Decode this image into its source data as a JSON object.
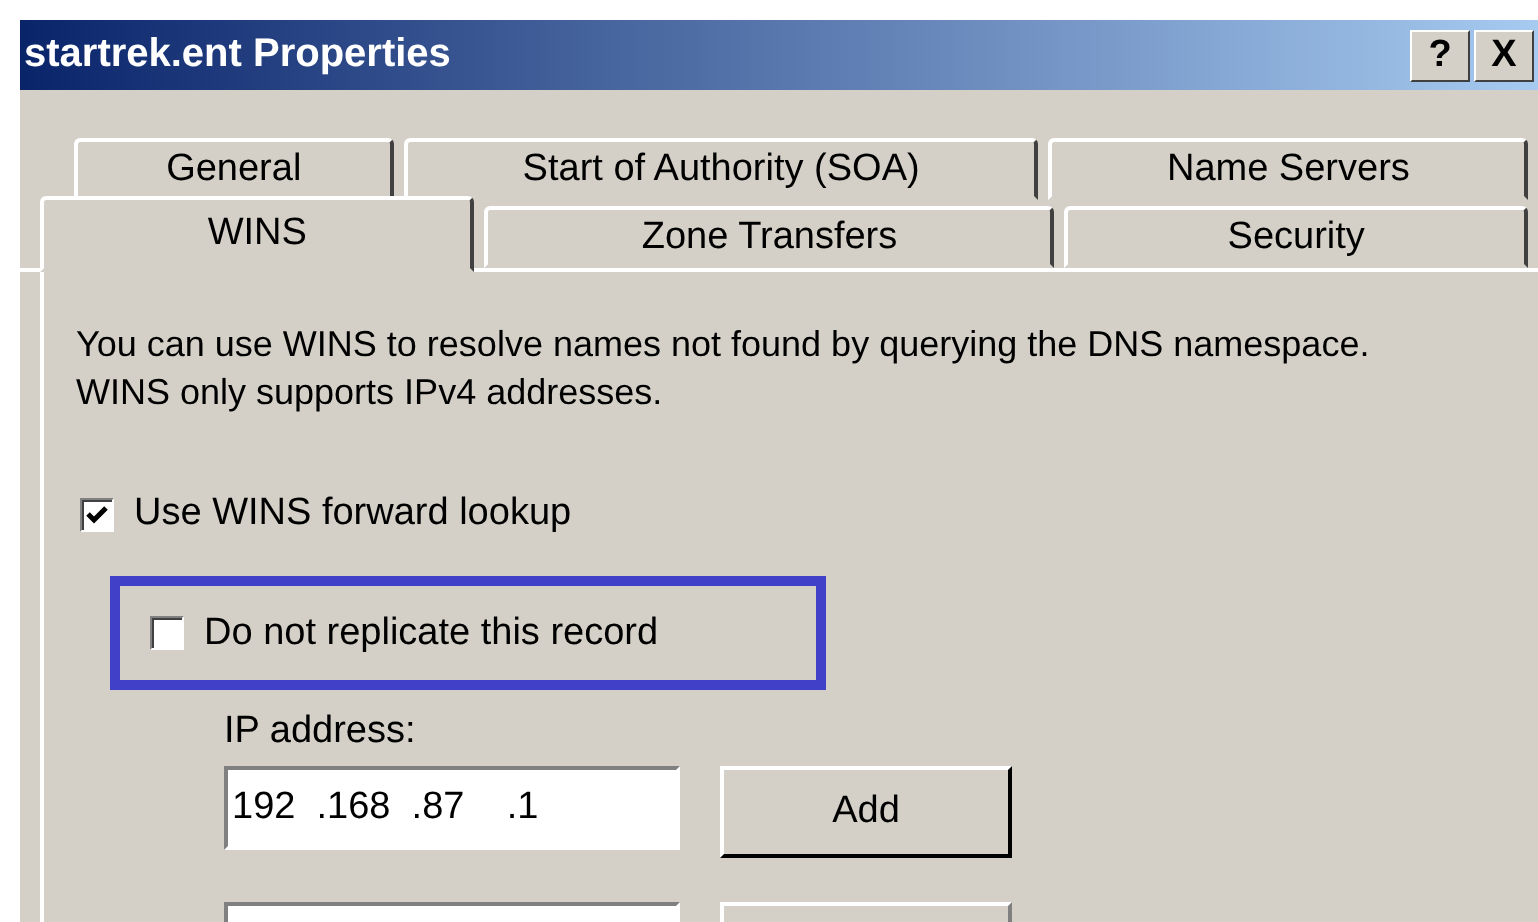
{
  "window": {
    "title": "startrek.ent Properties",
    "buttons": [
      "?",
      "X"
    ]
  },
  "tabs": [
    [
      {
        "label": "General",
        "selected": false
      },
      {
        "label": "Start of Authority (SOA)",
        "selected": false
      },
      {
        "label": "Name Servers",
        "selected": false
      }
    ],
    [
      {
        "label": "WINS",
        "selected": true
      },
      {
        "label": "Zone Transfers",
        "selected": false
      },
      {
        "label": "Security",
        "selected": false
      }
    ]
  ],
  "description": "You can use WINS to resolve names not found by querying the DNS namespace.  WINS only supports IPv4 addresses.",
  "options": [
    {
      "label": "Use WINS forward lookup",
      "checked": true,
      "highlighted": false
    },
    {
      "label": "Do not replicate this record",
      "checked": false,
      "highlighted": true
    }
  ],
  "ip_address": {
    "label": "IP address:",
    "value": "192  .168  .87    .1"
  },
  "add_button": "Add"
}
